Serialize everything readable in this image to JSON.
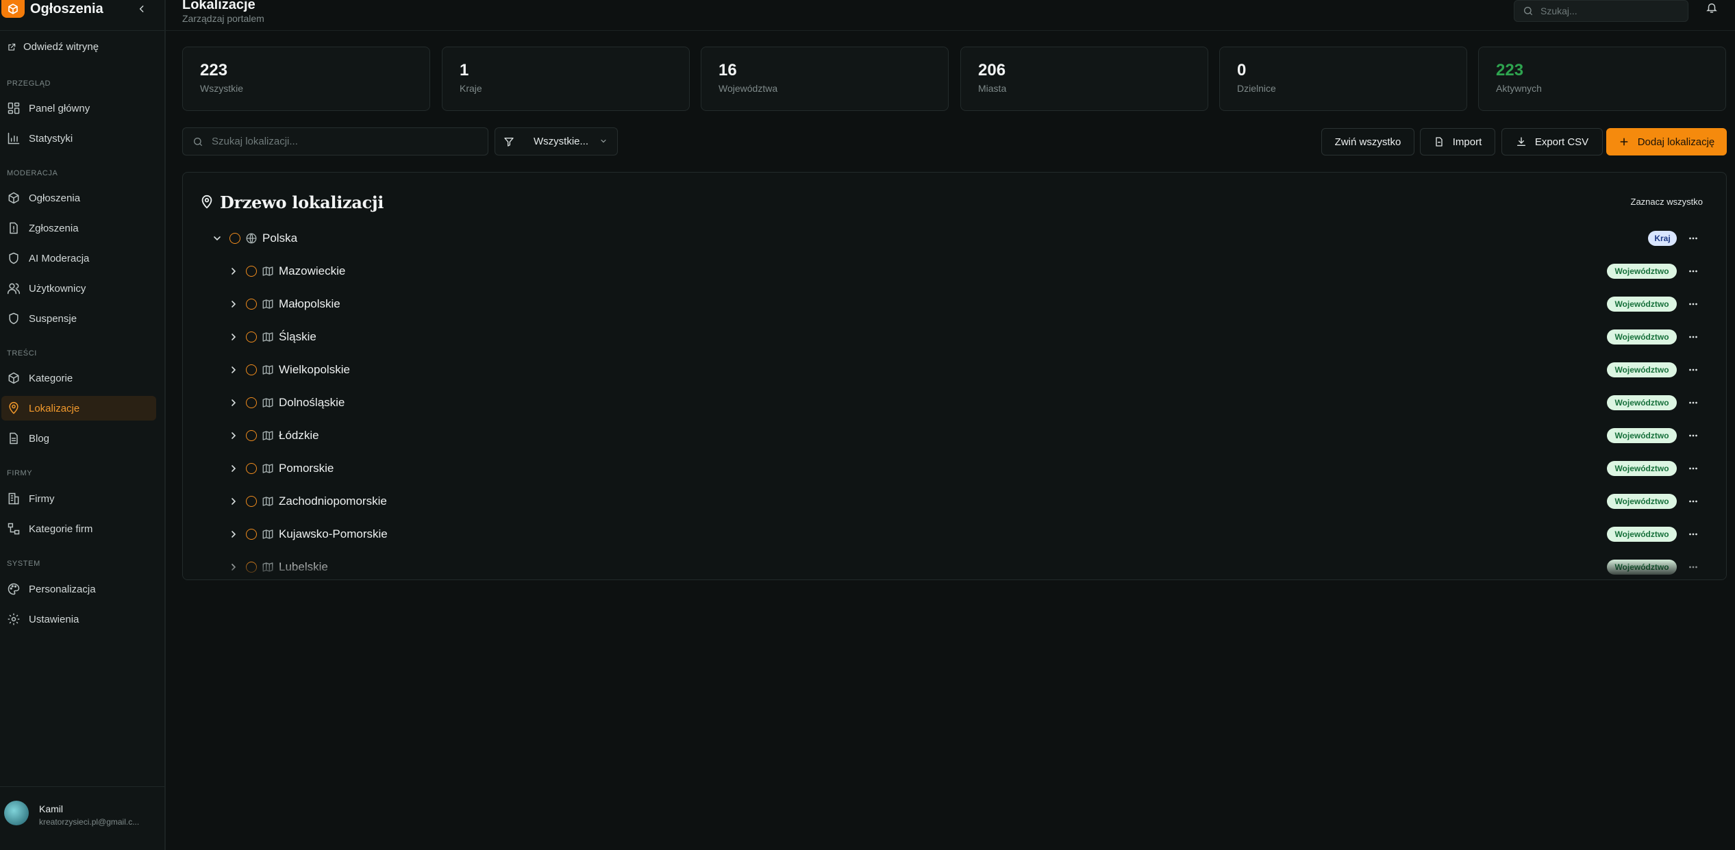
{
  "app": {
    "brand": "Ogłoszenia",
    "visit_site": "Odwiedź witrynę",
    "accent": "#f58a0d"
  },
  "sidebar": {
    "sections": [
      {
        "title": "PRZEGLĄD",
        "items": [
          {
            "label": "Panel główny",
            "icon": "dashboard-icon"
          },
          {
            "label": "Statystyki",
            "icon": "chart-icon"
          }
        ]
      },
      {
        "title": "MODERACJA",
        "items": [
          {
            "label": "Ogłoszenia",
            "icon": "package-icon"
          },
          {
            "label": "Zgłoszenia",
            "icon": "report-icon"
          },
          {
            "label": "AI Moderacja",
            "icon": "shield-icon"
          },
          {
            "label": "Użytkownicy",
            "icon": "users-icon"
          },
          {
            "label": "Suspensje",
            "icon": "shield-icon"
          }
        ]
      },
      {
        "title": "TREŚCI",
        "items": [
          {
            "label": "Kategorie",
            "icon": "package-icon"
          },
          {
            "label": "Lokalizacje",
            "icon": "map-pin-icon",
            "active": true
          },
          {
            "label": "Blog",
            "icon": "document-icon"
          }
        ]
      },
      {
        "title": "FIRMY",
        "items": [
          {
            "label": "Firmy",
            "icon": "building-icon"
          },
          {
            "label": "Kategorie firm",
            "icon": "sitemap-icon"
          }
        ]
      },
      {
        "title": "SYSTEM",
        "items": [
          {
            "label": "Personalizacja",
            "icon": "palette-icon"
          },
          {
            "label": "Ustawienia",
            "icon": "gear-icon"
          }
        ]
      }
    ],
    "user": {
      "name": "Kamil",
      "email": "kreatorzysieci.pl@gmail.c..."
    }
  },
  "header": {
    "title": "Lokalizacje",
    "subtitle": "Zarządzaj portalem",
    "search_placeholder": "Szukaj..."
  },
  "stats": [
    {
      "value": "223",
      "label": "Wszystkie",
      "color": "#f2f4f4"
    },
    {
      "value": "1",
      "label": "Kraje",
      "color": "#f2f4f4"
    },
    {
      "value": "16",
      "label": "Województwa",
      "color": "#f2f4f4"
    },
    {
      "value": "206",
      "label": "Miasta",
      "color": "#f2f4f4"
    },
    {
      "value": "0",
      "label": "Dzielnice",
      "color": "#f2f4f4"
    },
    {
      "value": "223",
      "label": "Aktywnych",
      "color": "#2ea44f"
    }
  ],
  "toolbar": {
    "search_placeholder": "Szukaj lokalizacji...",
    "filter_value": "Wszystkie...",
    "collapse_all": "Zwiń wszystko",
    "import": "Import",
    "export_csv": "Export CSV",
    "add_location": "Dodaj lokalizację"
  },
  "tree": {
    "title": "Drzewo lokalizacji",
    "select_all": "Zaznacz wszystko",
    "root": {
      "name": "Polska",
      "badge": "Kraj",
      "expanded": true
    },
    "children": [
      {
        "name": "Mazowieckie",
        "badge": "Województwo"
      },
      {
        "name": "Małopolskie",
        "badge": "Województwo"
      },
      {
        "name": "Śląskie",
        "badge": "Województwo"
      },
      {
        "name": "Wielkopolskie",
        "badge": "Województwo"
      },
      {
        "name": "Dolnośląskie",
        "badge": "Województwo"
      },
      {
        "name": "Łódzkie",
        "badge": "Województwo"
      },
      {
        "name": "Pomorskie",
        "badge": "Województwo"
      },
      {
        "name": "Zachodniopomorskie",
        "badge": "Województwo"
      },
      {
        "name": "Kujawsko-Pomorskie",
        "badge": "Województwo"
      },
      {
        "name": "Lubelskie",
        "badge": "Województwo"
      }
    ]
  }
}
